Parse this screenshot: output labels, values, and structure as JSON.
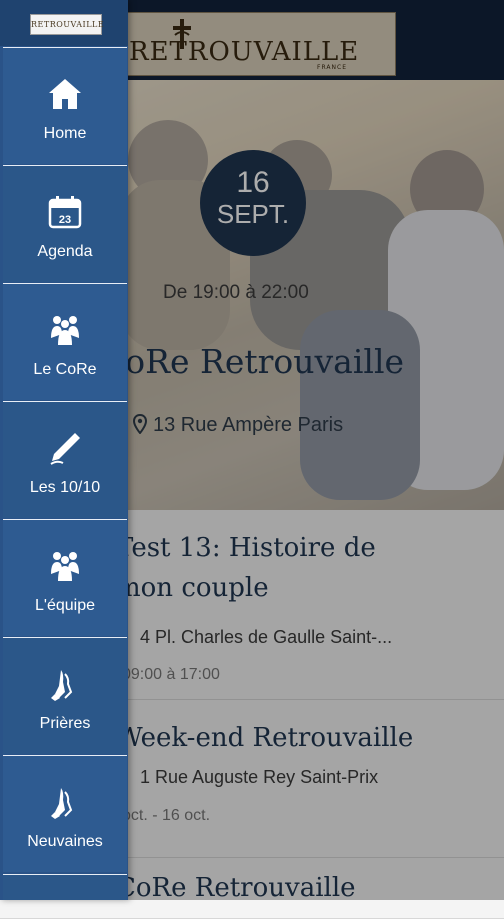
{
  "drawer": {
    "logo_text": "RETROUVAILLE",
    "items": [
      {
        "label": "Home",
        "icon": "home-icon"
      },
      {
        "label": "Agenda",
        "icon": "calendar-icon",
        "icon_text": "23"
      },
      {
        "label": "Le CoRe",
        "icon": "group-icon"
      },
      {
        "label": "Les 10/10",
        "icon": "pen-icon"
      },
      {
        "label": "L'équipe",
        "icon": "team-icon"
      },
      {
        "label": "Prières",
        "icon": "praying-hands-icon"
      },
      {
        "label": "Neuvaines",
        "icon": "praying-hands-icon"
      }
    ]
  },
  "header": {
    "logo_text": "RETROUVAILLE",
    "logo_subtext": "FRANCE"
  },
  "featured": {
    "day": "16",
    "month": "SEPT.",
    "time": "De 19:00 à 22:00",
    "title": "CoRe Retrouvaille",
    "location": "13 Rue Ampère Paris"
  },
  "events": [
    {
      "title": "Test 13: Histoire de mon couple",
      "location": "4 Pl. Charles de Gaulle Saint-...",
      "date": "09:00 à 17:00"
    },
    {
      "title": "Week-end Retrouvaille",
      "location": "1 Rue Auguste Rey Saint-Prix",
      "date": "oct. - 16 oct."
    },
    {
      "title": "CoRe Retrouvaille"
    }
  ],
  "colors": {
    "drawer_bg": "#2a5388",
    "header_bg": "#13233b",
    "accent_navy": "#1f3550"
  }
}
